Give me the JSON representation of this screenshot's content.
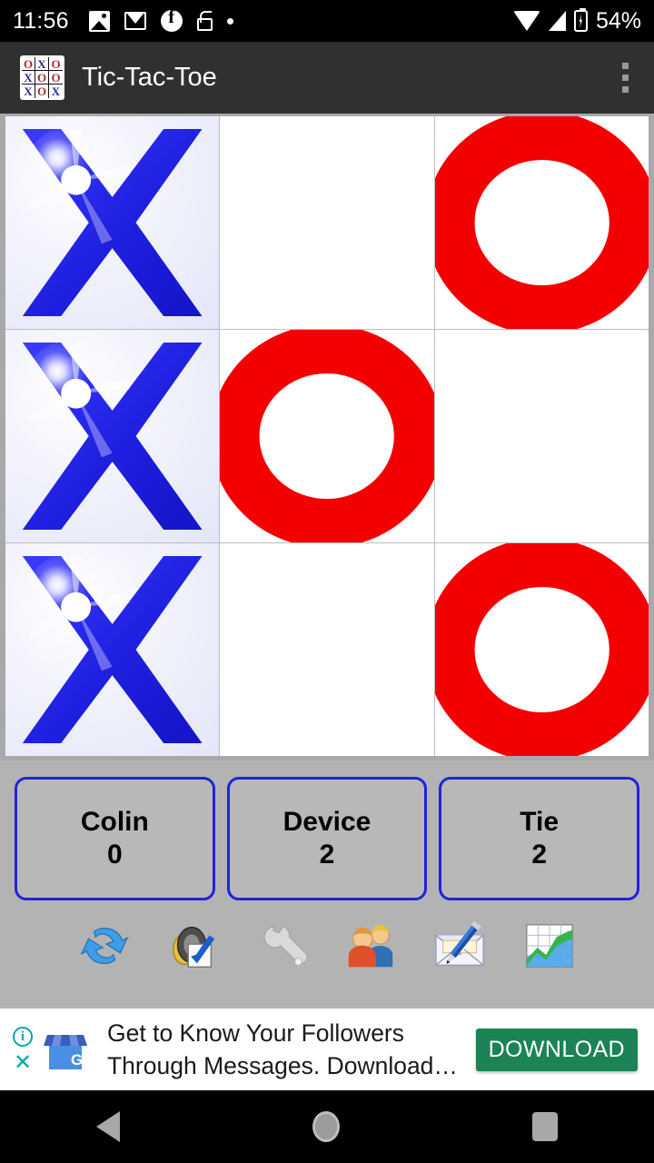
{
  "status_bar": {
    "time": "11:56",
    "left_icons": [
      "photo-icon",
      "gmail-icon",
      "facebook-icon",
      "unlock-icon",
      "dot-icon"
    ],
    "right_icons": [
      "wifi-icon",
      "signal-icon",
      "battery-icon"
    ],
    "battery": "54%"
  },
  "app_bar": {
    "title": "Tic-Tac-Toe",
    "icon": "tic-tac-toe-app-icon",
    "icon_grid": [
      "O",
      "X",
      "O",
      "X",
      "O",
      "O",
      "X",
      "O",
      "X"
    ],
    "overflow": "overflow-menu-icon"
  },
  "board": {
    "cells": [
      {
        "id": "cell-0",
        "mark": "X",
        "position": "top-left"
      },
      {
        "id": "cell-1",
        "mark": "",
        "position": "top-center"
      },
      {
        "id": "cell-2",
        "mark": "O",
        "position": "top-right"
      },
      {
        "id": "cell-3",
        "mark": "X",
        "position": "middle-left"
      },
      {
        "id": "cell-4",
        "mark": "O",
        "position": "middle-center"
      },
      {
        "id": "cell-5",
        "mark": "",
        "position": "middle-right"
      },
      {
        "id": "cell-6",
        "mark": "X",
        "position": "bottom-left"
      },
      {
        "id": "cell-7",
        "mark": "",
        "position": "bottom-center"
      },
      {
        "id": "cell-8",
        "mark": "O",
        "position": "bottom-right"
      }
    ],
    "x_color": "#1f1fe0",
    "o_color": "#f40000"
  },
  "scores": [
    {
      "name": "Colin",
      "value": "0"
    },
    {
      "name": "Device",
      "value": "2"
    },
    {
      "name": "Tie",
      "value": "2"
    }
  ],
  "toolbar": [
    {
      "icon": "refresh-icon",
      "label": "New Game"
    },
    {
      "icon": "sound-icon",
      "label": "Sound"
    },
    {
      "icon": "wrench-icon",
      "label": "Settings"
    },
    {
      "icon": "players-icon",
      "label": "Players"
    },
    {
      "icon": "mail-compose-icon",
      "label": "Feedback"
    },
    {
      "icon": "stats-chart-icon",
      "label": "Statistics"
    }
  ],
  "ad": {
    "info_icon": "ad-info-icon",
    "close_icon": "ad-close-icon",
    "advertiser_icon": "google-my-business-icon",
    "line1": "Get to Know Your Followers",
    "line2": "Through Messages. Download…",
    "cta": "DOWNLOAD",
    "cta_color": "#1b8354"
  },
  "nav_bar": {
    "back": "back-nav-icon",
    "home": "home-nav-icon",
    "recents": "recents-nav-icon"
  }
}
